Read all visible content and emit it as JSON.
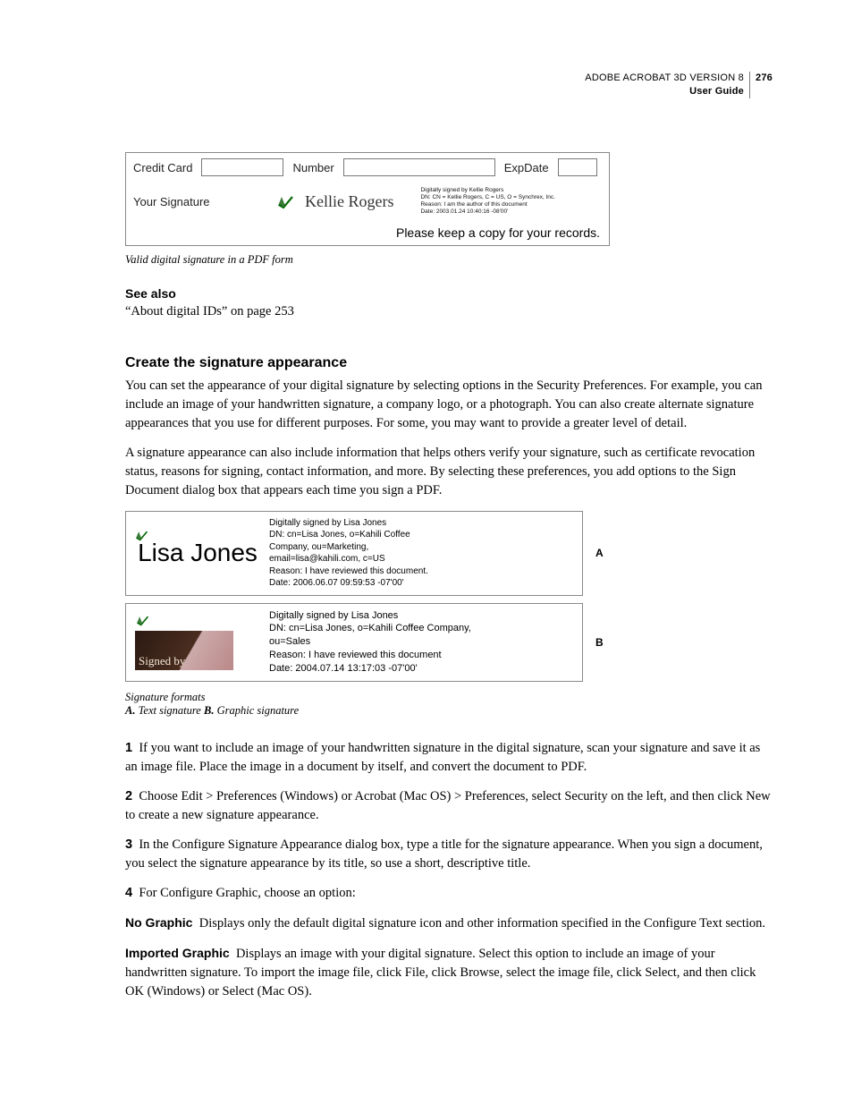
{
  "header": {
    "product": "ADOBE ACROBAT 3D VERSION 8",
    "doc": "User Guide",
    "page": "276"
  },
  "figure1": {
    "labels": {
      "credit_card": "Credit Card",
      "number": "Number",
      "expdate": "ExpDate",
      "your_sig": "Your Signature"
    },
    "signature_name": "Kellie Rogers",
    "sig_details": {
      "l1": "Digitally signed by Kellie Rogers",
      "l2": "DN: CN = Kellie Rogers, C = US, O = Synchrex, Inc.",
      "l3": "Reason: I am the author of this document",
      "l4": "Date: 2003.01.24 10:40:16 -08'00'"
    },
    "footer": "Please keep a copy for your records.",
    "caption": "Valid digital signature in a PDF form"
  },
  "see_also": {
    "heading": "See also",
    "ref": "“About digital IDs” on page 253"
  },
  "section": {
    "heading": "Create the signature appearance",
    "p1": "You can set the appearance of your digital signature by selecting options in the Security Preferences. For example, you can include an image of your handwritten signature, a company logo, or a photograph. You can also create alternate signature appearances that you use for different purposes. For some, you may want to provide a greater level of detail.",
    "p2": "A signature appearance can also include information that helps others verify your signature, such as certificate revocation status, reasons for signing, contact information, and more. By selecting these preferences, you add options to the Sign Document dialog box that appears each time you sign a PDF."
  },
  "figure2": {
    "a": {
      "name": "Lisa Jones",
      "l1": "Digitally signed by Lisa Jones",
      "l2": "DN: cn=Lisa Jones, o=Kahili Coffee",
      "l3": "Company, ou=Marketing,",
      "l4": "email=lisa@kahili.com, c=US",
      "l5": "Reason: I have reviewed this document.",
      "l6": "Date: 2006.06.07 09:59:53 -07'00'",
      "callout": "A"
    },
    "b": {
      "photo_label": "Signed by",
      "l1": "Digitally signed by Lisa Jones",
      "l2": "DN: cn=Lisa Jones, o=Kahili Coffee Company,",
      "l3": "ou=Sales",
      "l4": "Reason: I have reviewed this document",
      "l5": "Date: 2004.07.14 13:17:03 -07'00'",
      "callout": "B"
    },
    "caption_line1": "Signature formats",
    "caption_a_label": "A.",
    "caption_a_text": " Text signature  ",
    "caption_b_label": "B.",
    "caption_b_text": " Graphic signature"
  },
  "steps": {
    "s1_num": "1",
    "s1": "If you want to include an image of your handwritten signature in the digital signature, scan your signature and save it as an image file. Place the image in a document by itself, and convert the document to PDF.",
    "s2_num": "2",
    "s2": "Choose Edit > Preferences (Windows) or Acrobat (Mac OS) > Preferences, select Security on the left, and then click New to create a new signature appearance.",
    "s3_num": "3",
    "s3": "In the Configure Signature Appearance dialog box, type a title for the signature appearance. When you sign a document, you select the signature appearance by its title, so use a short, descriptive title.",
    "s4_num": "4",
    "s4": "For Configure Graphic, choose an option:",
    "no_graphic_label": "No Graphic",
    "no_graphic_text": "Displays only the default digital signature icon and other information specified in the Configure Text section.",
    "imported_label": "Imported Graphic",
    "imported_text": "Displays an image with your digital signature. Select this option to include an image of your handwritten signature. To import the image file, click File, click Browse, select the image file, click Select, and then click OK (Windows) or Select (Mac OS)."
  }
}
